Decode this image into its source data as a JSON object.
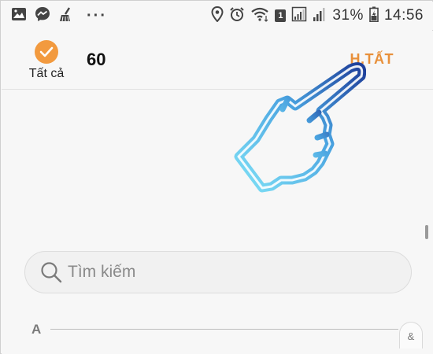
{
  "status_bar": {
    "battery_percent": "31%",
    "time": "14:56",
    "sim_badge": "1",
    "left_icons": [
      "gallery-icon",
      "messenger-icon",
      "cleaner-icon"
    ],
    "right_icons": [
      "location-icon",
      "alarm-icon",
      "wifi-icon",
      "sim-signal-icon",
      "signal-icon",
      "battery-icon"
    ]
  },
  "header": {
    "select_all_label": "Tất cả",
    "selected_count": "60",
    "done_label": "H.TẤT",
    "select_all_checked": true
  },
  "search": {
    "placeholder": "Tìm kiếm"
  },
  "list": {
    "section_letter": "A"
  },
  "index_scroller": {
    "first_item": "&"
  },
  "colors": {
    "accent": "#e8903a",
    "check_circle": "#f29a3f",
    "hand_pointer_outer": "#3f73c8",
    "hand_pointer_inner": "#6fd3f0"
  }
}
